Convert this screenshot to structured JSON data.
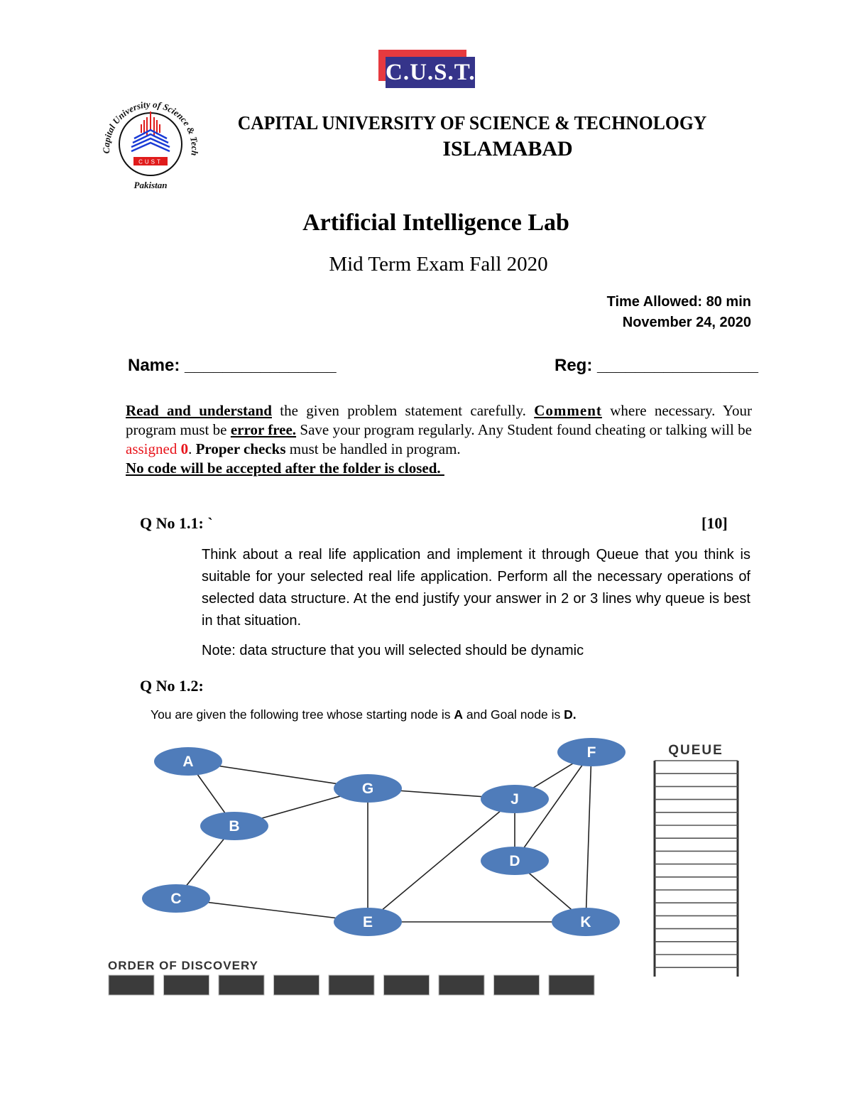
{
  "header": {
    "badge_text": "C.U.S.T.",
    "seal": {
      "ring_text_top": "Capital University of Science & Technology",
      "ring_text_bottom": "Pakistan",
      "banner_text": "CUST"
    },
    "university_name": "CAPITAL UNIVERSITY OF SCIENCE & TECHNOLOGY",
    "city": "ISLAMABAD"
  },
  "exam": {
    "course": "Artificial Intelligence Lab",
    "title": "Mid Term Exam Fall 2020",
    "time_allowed": "Time Allowed: 80 min",
    "date": "November 24, 2020"
  },
  "fields": {
    "name_label": "Name: ________________",
    "reg_label": "Reg: _________________"
  },
  "instructions": {
    "p1_bold": "Read and understand",
    "p1_rest": " the given problem statement carefully. ",
    "p2_bold": "Comment",
    "p2_rest": " where necessary. Your program must be ",
    "p3_bold": "error free.",
    "p3_rest": " Save your program regularly. Any Student found cheating or talking will be ",
    "p4_red": "assigned ",
    "p4_red_bold": "0",
    "p4_rest": ". ",
    "p5_bold": "Proper checks",
    "p5_rest": " must be handled in program.",
    "closing": "No code will be accepted after the folder is closed. "
  },
  "questions": {
    "q11": {
      "label": "Q No 1.1: `",
      "marks": "[10]",
      "body": "Think about a real life application and implement it through Queue that you think is suitable for your selected real life application. Perform all the necessary operations of selected data structure. At the end justify your answer in 2 or 3 lines why queue is best in that situation.",
      "note": "Note: data structure that you will selected should be dynamic"
    },
    "q12": {
      "label": "Q No 1.2:",
      "body_pre": "You are given the following tree whose starting node is ",
      "start_node": "A",
      "body_mid": " and Goal node is ",
      "goal_node": "D."
    }
  },
  "graph": {
    "node_color": "#4f7cba",
    "nodes": [
      "A",
      "B",
      "C",
      "G",
      "E",
      "J",
      "D",
      "F",
      "K"
    ],
    "edges": [
      [
        "A",
        "B"
      ],
      [
        "A",
        "G"
      ],
      [
        "B",
        "G"
      ],
      [
        "B",
        "C"
      ],
      [
        "C",
        "E"
      ],
      [
        "G",
        "E"
      ],
      [
        "G",
        "J"
      ],
      [
        "E",
        "J"
      ],
      [
        "E",
        "K"
      ],
      [
        "J",
        "F"
      ],
      [
        "J",
        "D"
      ],
      [
        "F",
        "D"
      ],
      [
        "F",
        "K"
      ],
      [
        "D",
        "K"
      ]
    ],
    "queue_title": "QUEUE",
    "queue_slots": 16,
    "order_title": "ORDER OF DISCOVERY",
    "order_slots": 9
  }
}
